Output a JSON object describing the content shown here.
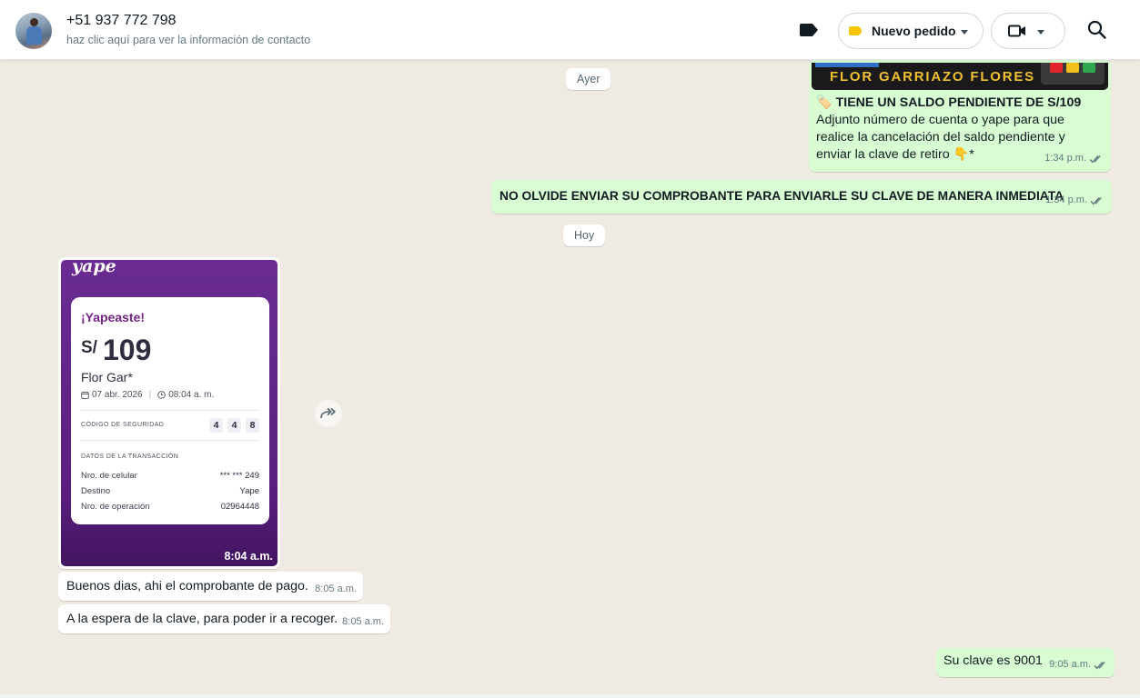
{
  "header": {
    "contact_name": "+51 937 772 798",
    "contact_subtitle": "haz clic aquí para ver la información de contacto",
    "order_label": "Nuevo pedido",
    "icons": [
      "label-icon",
      "tag-icon",
      "video-call-icon",
      "search-icon"
    ]
  },
  "dates": {
    "yesterday": "Ayer",
    "today": "Hoy"
  },
  "messages": {
    "m1": {
      "image_caption": "FLOR GARRIAZO FLORES",
      "title": "🏷️ TIENE UN SALDO PENDIENTE DE S/109",
      "body": " Adjunto número de cuenta o yape para que realice la cancelación del saldo pendiente y enviar la clave de retiro 👇*",
      "time": "1:34 p.m."
    },
    "m2": {
      "text": "NO OLVIDE ENVIAR SU COMPROBANTE PARA ENVIARLE SU CLAVE DE MANERA INMEDIATA",
      "time": "1:34 p.m."
    },
    "yape_receipt": {
      "logo": "yape",
      "heading": "¡Yapeaste!",
      "currency": "S/",
      "amount": "109",
      "recipient": "Flor Gar*",
      "date": "07 abr. 2026",
      "time_of_day": "08:04 a. m.",
      "security_label": "CÓDIGO DE SEGURIDAD",
      "security_digits": [
        "4",
        "4",
        "8"
      ],
      "details_label": "DATOS DE LA TRANSACCIÓN",
      "rows": [
        {
          "label": "Nro. de celular",
          "value": "*** *** 249"
        },
        {
          "label": "Destino",
          "value": "Yape"
        },
        {
          "label": "Nro. de operación",
          "value": "02964448"
        }
      ],
      "time": "8:04 a.m."
    },
    "m3": {
      "text": "Buenos dias, ahi el comprobante de pago.",
      "time": "8:05 a.m."
    },
    "m4": {
      "text": "A la espera de la clave, para poder ir a recoger.",
      "time": "8:05 a.m."
    },
    "m5": {
      "text": "Su clave es 9001",
      "time": "9:05 a.m."
    }
  },
  "colors": {
    "outgoing_bubble": "#d9fdd3",
    "incoming_bubble": "#ffffff",
    "chat_background": "#efeae2",
    "read_ticks": "#667781",
    "yape_purple": "#6a2c92"
  }
}
